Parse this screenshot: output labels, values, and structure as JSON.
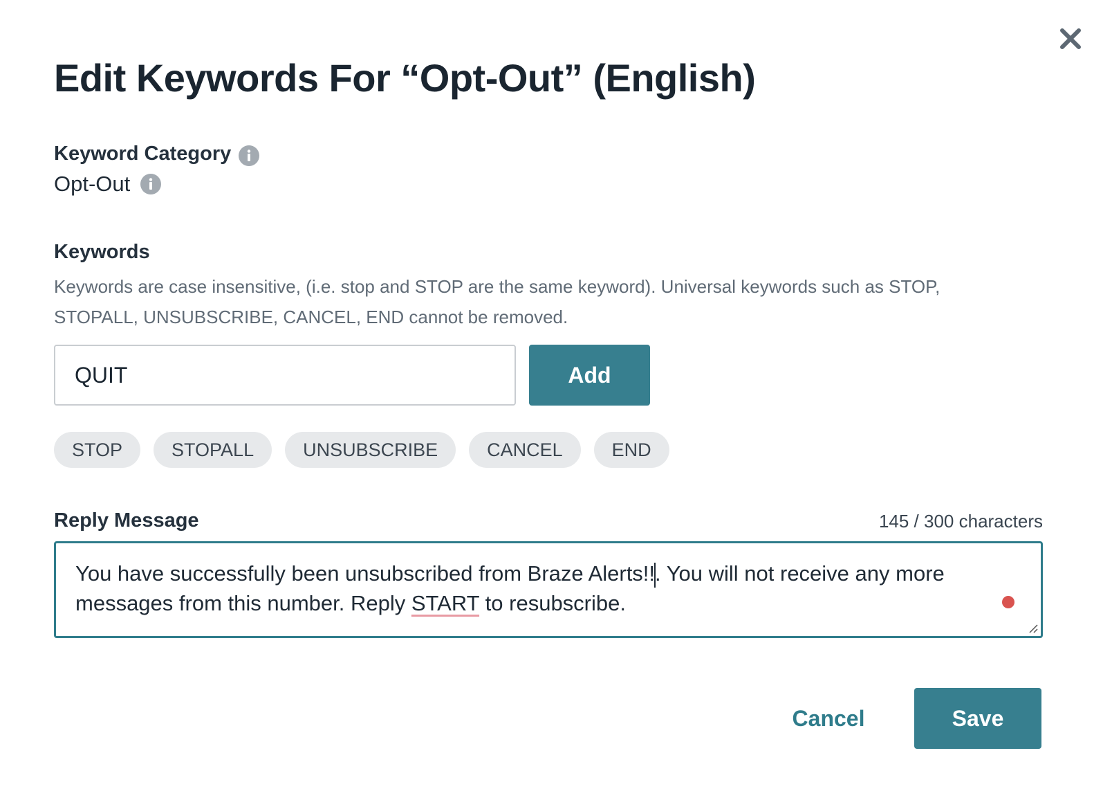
{
  "dialog": {
    "title": "Edit Keywords For “Opt-Out” (English)",
    "close_icon": "close-icon"
  },
  "keyword_category": {
    "label": "Keyword Category",
    "value": "Opt-Out",
    "info_icon": "info-icon"
  },
  "keywords": {
    "label": "Keywords",
    "description": "Keywords are case insensitive, (i.e. stop and STOP are the same keyword). Universal keywords such as STOP, STOPALL, UNSUBSCRIBE, CANCEL, END cannot be removed.",
    "input_value": "QUIT",
    "add_label": "Add",
    "chips": [
      "STOP",
      "STOPALL",
      "UNSUBSCRIBE",
      "CANCEL",
      "END"
    ]
  },
  "reply": {
    "label": "Reply Message",
    "char_count": "145 / 300 characters",
    "text_part1": "You have successfully been unsubscribed from Braze Alerts!!",
    "text_part2": ". You will not receive any more messages from this number. Reply ",
    "text_underlined": "START",
    "text_part3": " to resubscribe."
  },
  "footer": {
    "cancel_label": "Cancel",
    "save_label": "Save"
  },
  "colors": {
    "primary": "#377f8f",
    "focus_border": "#2f7c8b",
    "chip_bg": "#e7e9eb",
    "grammar_dot": "#d9534f"
  }
}
